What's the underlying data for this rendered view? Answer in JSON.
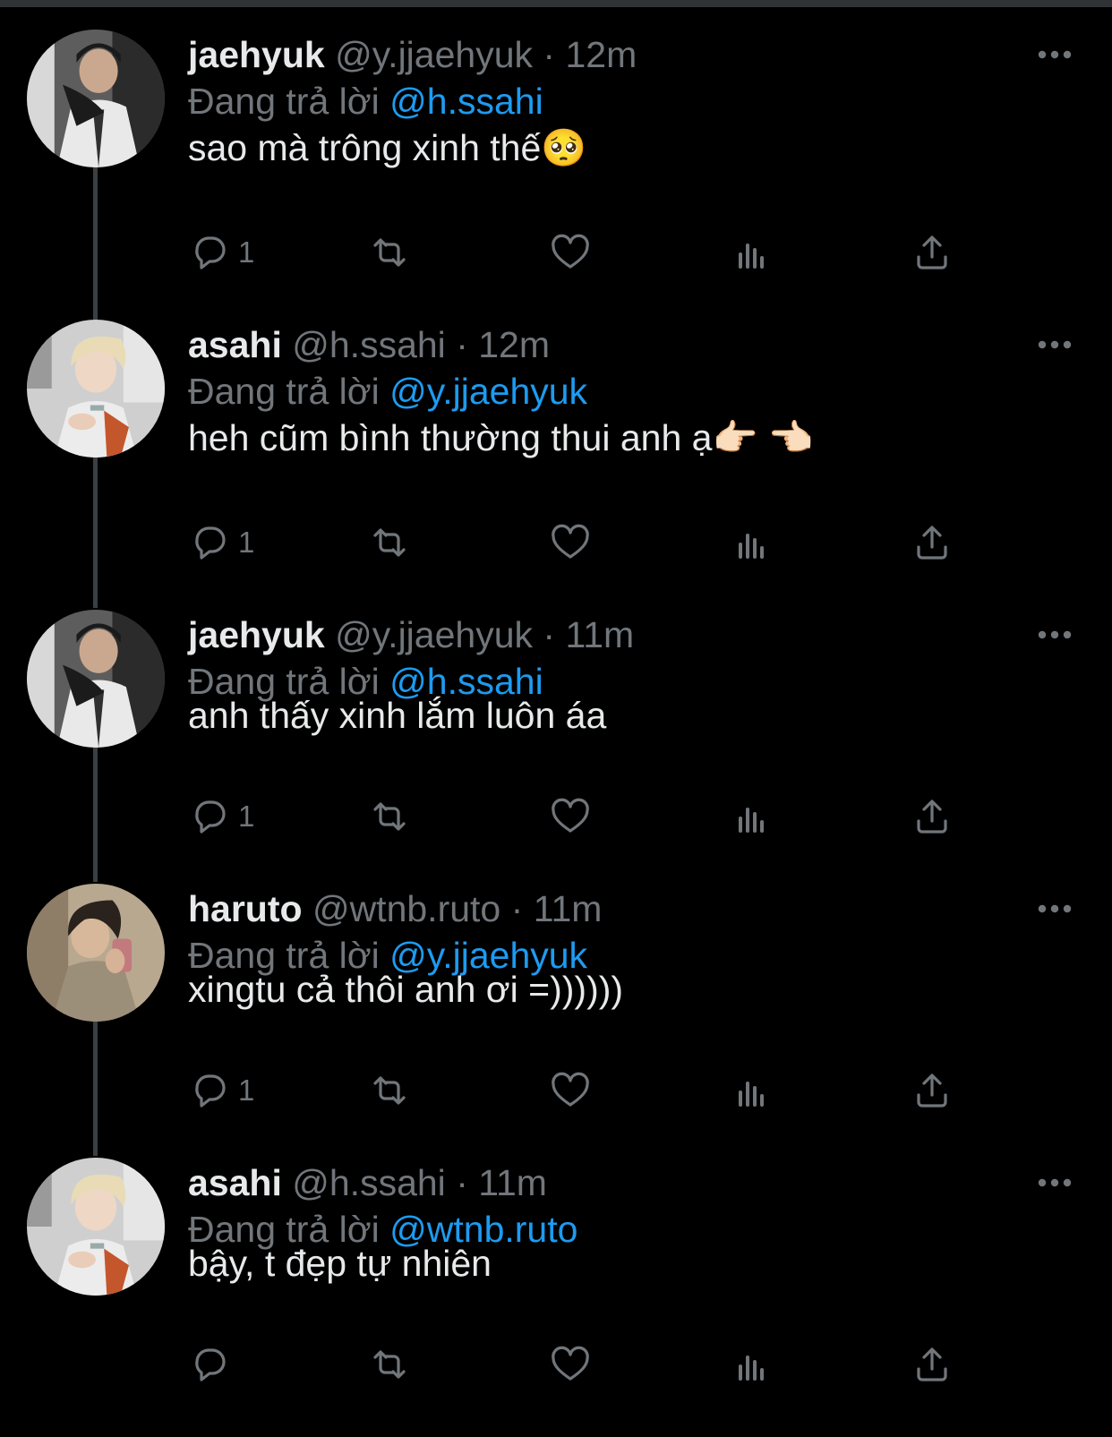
{
  "theme": {
    "background": "#000000",
    "text": "#e7e9ea",
    "muted": "#71767b",
    "accent": "#1d9bf0",
    "thread_line": "#3a3f43"
  },
  "reply_prefix": "Đang trả lời",
  "tweets": [
    {
      "name": "jaehyuk",
      "handle": "@y.jjaehyuk",
      "separator": "·",
      "time": "12m",
      "replying_to": "@h.ssahi",
      "text": "sao mà trông xinh thế🥺",
      "reply_count": "1",
      "avatar": "avatar-jaehyuk"
    },
    {
      "name": "asahi",
      "handle": "@h.ssahi",
      "separator": "·",
      "time": "12m",
      "replying_to": "@y.jjaehyuk",
      "text": "heh cũm bình thường thui anh ạ👉🏻 👈🏻",
      "reply_count": "1",
      "avatar": "avatar-asahi"
    },
    {
      "name": "jaehyuk",
      "handle": "@y.jjaehyuk",
      "separator": "·",
      "time": "11m",
      "replying_to": "@h.ssahi",
      "text": "anh thấy xinh lắm luôn áa",
      "reply_count": "1",
      "avatar": "avatar-jaehyuk"
    },
    {
      "name": "haruto",
      "handle": "@wtnb.ruto",
      "separator": "·",
      "time": "11m",
      "replying_to": "@y.jjaehyuk",
      "text": "xingtu cả thôi anh ơi =))))))",
      "reply_count": "1",
      "avatar": "avatar-haruto"
    },
    {
      "name": "asahi",
      "handle": "@h.ssahi",
      "separator": "·",
      "time": "11m",
      "replying_to": "@wtnb.ruto",
      "text": "bậy, t đẹp tự nhiên",
      "reply_count": "",
      "avatar": "avatar-asahi"
    }
  ],
  "icons": {
    "more": "more-horizontal-icon",
    "reply": "reply-icon",
    "retweet": "retweet-icon",
    "like": "heart-icon",
    "views": "views-icon",
    "share": "share-icon"
  }
}
